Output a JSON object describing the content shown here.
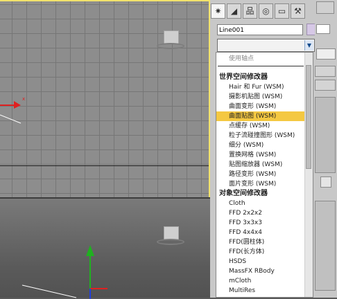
{
  "viewport_top": {
    "axis_label": "x"
  },
  "panel": {
    "tabs": [
      "create-tab",
      "modify-tab",
      "hierarchy-tab",
      "motion-tab",
      "display-tab",
      "utilities-tab"
    ],
    "object_name": "Line001",
    "modifier_list_value": ""
  },
  "dropdown": {
    "pivot_option": "使用轴点",
    "world_header": "世界空间修改器",
    "world_items": [
      "Hair 和 Fur (WSM)",
      "摄影机贴图 (WSM)",
      "曲面变形 (WSM)",
      "曲面贴图 (WSM)",
      "点缓存 (WSM)",
      "粒子流碰撞图形 (WSM)",
      "细分 (WSM)",
      "置换网格 (WSM)",
      "贴图缩放器 (WSM)",
      "路径变形 (WSM)",
      "面片变形 (WSM)"
    ],
    "selected_index": 3,
    "object_header": "对象空间修改器",
    "object_items": [
      "Cloth",
      "FFD 2x2x2",
      "FFD 3x3x3",
      "FFD 4x4x4",
      "FFD(圆柱体)",
      "FFD(长方体)",
      "HSDS",
      "MassFX RBody",
      "mCloth",
      "MultiRes"
    ]
  },
  "colors": {
    "selection_highlight": "#f4c842",
    "active_viewport_border": "#f2e26b",
    "x_axis": "#e02020",
    "y_axis": "#20b020",
    "object_color_swatch": "#d6c8e6"
  }
}
